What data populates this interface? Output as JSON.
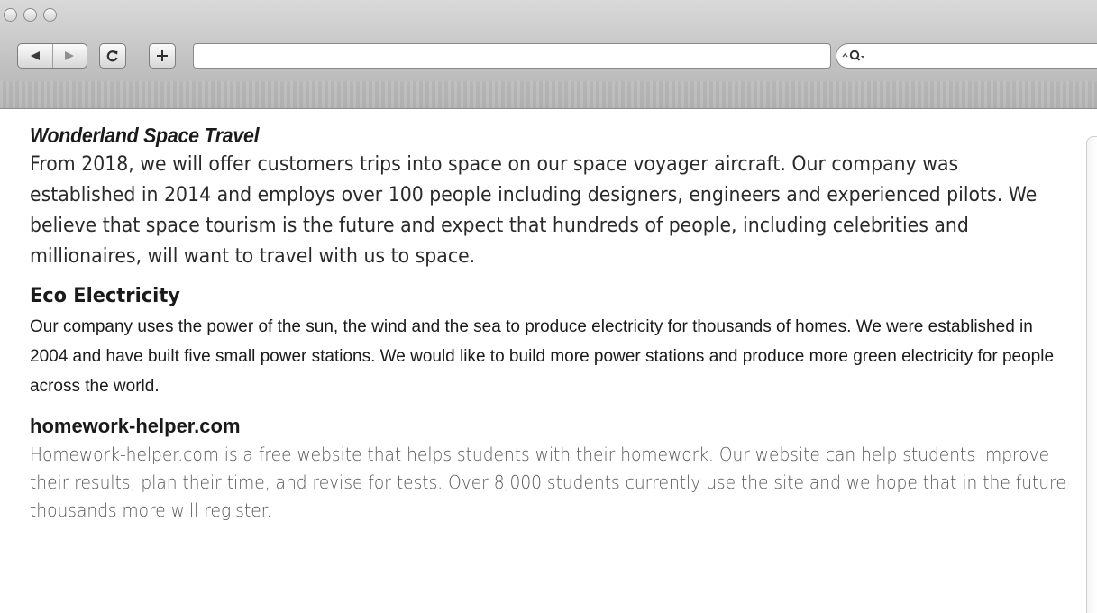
{
  "browser": {
    "address_value": "",
    "search_value": "",
    "reload_glyph": "C",
    "new_tab_glyph": "+"
  },
  "sites": [
    {
      "title": "Wonderland Space Travel",
      "body": "From 2018, we will offer customers trips into space on our space voyager aircraft. Our company was established in 2014 and employs over 100 people including designers, engineers and experienced pilots. We believe that space tourism is the future and expect that hundreds of people, including celebrities and millionaires, will want to travel with us to space."
    },
    {
      "title": "Eco Electricity",
      "body": "Our company uses the power of the sun, the wind and the sea to produce electricity for thousands of homes. We were established in 2004 and have built five small power stations. We would like to build more power stations and produce more green electricity for people across the world."
    },
    {
      "title": "homework-helper.com",
      "body": "Homework-helper.com is a free website that helps students with their homework. Our website can help students improve their results, plan their time, and revise for tests. Over 8,000 students currently use the site and we hope that in the future thousands more will register."
    }
  ]
}
